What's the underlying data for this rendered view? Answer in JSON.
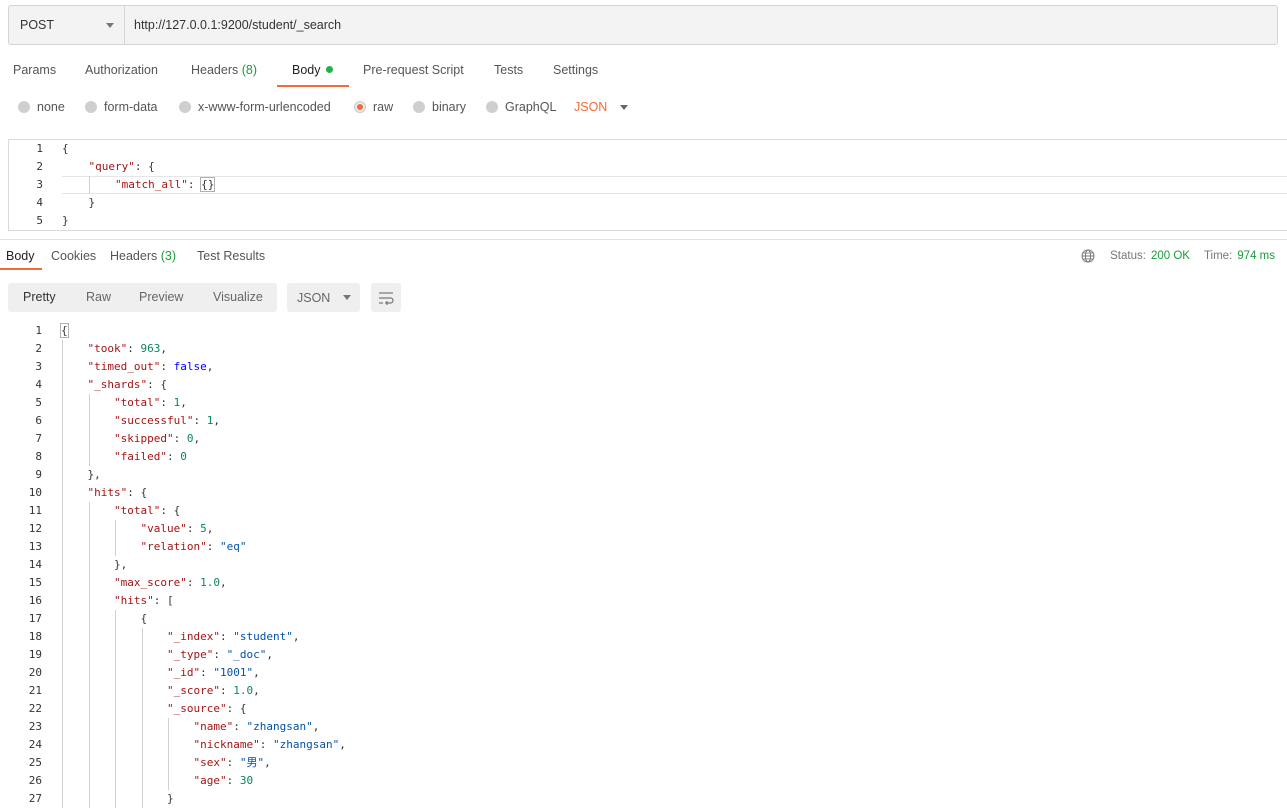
{
  "request": {
    "method": "POST",
    "url": "http://127.0.0.1:9200/student/_search"
  },
  "request_tabs": [
    {
      "label": "Params"
    },
    {
      "label": "Authorization"
    },
    {
      "label": "Headers",
      "count": "(8)"
    },
    {
      "label": "Body",
      "active": true
    },
    {
      "label": "Pre-request Script"
    },
    {
      "label": "Tests"
    },
    {
      "label": "Settings"
    }
  ],
  "body_types": [
    {
      "label": "none"
    },
    {
      "label": "form-data"
    },
    {
      "label": "x-www-form-urlencoded"
    },
    {
      "label": "raw",
      "checked": true
    },
    {
      "label": "binary"
    },
    {
      "label": "GraphQL"
    }
  ],
  "body_format": "JSON",
  "request_body_lines": [
    "1",
    "2",
    "3",
    "4",
    "5"
  ],
  "request_body_tokens": {
    "open": "{",
    "query_key": "\"query\"",
    "colon": ": ",
    "open2": "{",
    "match_all_key": "\"match_all\"",
    "match_all_value": "{}",
    "close2": "}",
    "close": "}"
  },
  "response_tabs": [
    {
      "label": "Body",
      "active": true
    },
    {
      "label": "Cookies"
    },
    {
      "label": "Headers",
      "count": "(3)"
    },
    {
      "label": "Test Results"
    }
  ],
  "status": {
    "status_label": "Status:",
    "status_value": "200 OK",
    "time_label": "Time:",
    "time_value": "974 ms"
  },
  "view_modes": [
    "Pretty",
    "Raw",
    "Preview",
    "Visualize"
  ],
  "response_format": "JSON",
  "response_lines": [
    {
      "n": "1",
      "i": 0,
      "t": [
        [
          "p",
          "{"
        ]
      ]
    },
    {
      "n": "2",
      "i": 1,
      "t": [
        [
          "k",
          "\"took\""
        ],
        [
          "p",
          ": "
        ],
        [
          "n",
          "963"
        ],
        [
          "p",
          ","
        ]
      ]
    },
    {
      "n": "3",
      "i": 1,
      "t": [
        [
          "k",
          "\"timed_out\""
        ],
        [
          "p",
          ": "
        ],
        [
          "b",
          "false"
        ],
        [
          "p",
          ","
        ]
      ]
    },
    {
      "n": "4",
      "i": 1,
      "t": [
        [
          "k",
          "\"_shards\""
        ],
        [
          "p",
          ": {"
        ]
      ]
    },
    {
      "n": "5",
      "i": 2,
      "t": [
        [
          "k",
          "\"total\""
        ],
        [
          "p",
          ": "
        ],
        [
          "n",
          "1"
        ],
        [
          "p",
          ","
        ]
      ]
    },
    {
      "n": "6",
      "i": 2,
      "t": [
        [
          "k",
          "\"successful\""
        ],
        [
          "p",
          ": "
        ],
        [
          "n",
          "1"
        ],
        [
          "p",
          ","
        ]
      ]
    },
    {
      "n": "7",
      "i": 2,
      "t": [
        [
          "k",
          "\"skipped\""
        ],
        [
          "p",
          ": "
        ],
        [
          "n",
          "0"
        ],
        [
          "p",
          ","
        ]
      ]
    },
    {
      "n": "8",
      "i": 2,
      "t": [
        [
          "k",
          "\"failed\""
        ],
        [
          "p",
          ": "
        ],
        [
          "n",
          "0"
        ]
      ]
    },
    {
      "n": "9",
      "i": 1,
      "t": [
        [
          "p",
          "},"
        ]
      ]
    },
    {
      "n": "10",
      "i": 1,
      "t": [
        [
          "k",
          "\"hits\""
        ],
        [
          "p",
          ": {"
        ]
      ]
    },
    {
      "n": "11",
      "i": 2,
      "t": [
        [
          "k",
          "\"total\""
        ],
        [
          "p",
          ": {"
        ]
      ]
    },
    {
      "n": "12",
      "i": 3,
      "t": [
        [
          "k",
          "\"value\""
        ],
        [
          "p",
          ": "
        ],
        [
          "n",
          "5"
        ],
        [
          "p",
          ","
        ]
      ]
    },
    {
      "n": "13",
      "i": 3,
      "t": [
        [
          "k",
          "\"relation\""
        ],
        [
          "p",
          ": "
        ],
        [
          "s",
          "\"eq\""
        ]
      ]
    },
    {
      "n": "14",
      "i": 2,
      "t": [
        [
          "p",
          "},"
        ]
      ]
    },
    {
      "n": "15",
      "i": 2,
      "t": [
        [
          "k",
          "\"max_score\""
        ],
        [
          "p",
          ": "
        ],
        [
          "n",
          "1.0"
        ],
        [
          "p",
          ","
        ]
      ]
    },
    {
      "n": "16",
      "i": 2,
      "t": [
        [
          "k",
          "\"hits\""
        ],
        [
          "p",
          ": ["
        ]
      ]
    },
    {
      "n": "17",
      "i": 3,
      "t": [
        [
          "p",
          "{"
        ]
      ]
    },
    {
      "n": "18",
      "i": 4,
      "t": [
        [
          "k",
          "\"_index\""
        ],
        [
          "p",
          ": "
        ],
        [
          "s",
          "\"student\""
        ],
        [
          "p",
          ","
        ]
      ]
    },
    {
      "n": "19",
      "i": 4,
      "t": [
        [
          "k",
          "\"_type\""
        ],
        [
          "p",
          ": "
        ],
        [
          "s",
          "\"_doc\""
        ],
        [
          "p",
          ","
        ]
      ]
    },
    {
      "n": "20",
      "i": 4,
      "t": [
        [
          "k",
          "\"_id\""
        ],
        [
          "p",
          ": "
        ],
        [
          "s",
          "\"1001\""
        ],
        [
          "p",
          ","
        ]
      ]
    },
    {
      "n": "21",
      "i": 4,
      "t": [
        [
          "k",
          "\"_score\""
        ],
        [
          "p",
          ": "
        ],
        [
          "n",
          "1.0"
        ],
        [
          "p",
          ","
        ]
      ]
    },
    {
      "n": "22",
      "i": 4,
      "t": [
        [
          "k",
          "\"_source\""
        ],
        [
          "p",
          ": {"
        ]
      ]
    },
    {
      "n": "23",
      "i": 5,
      "t": [
        [
          "k",
          "\"name\""
        ],
        [
          "p",
          ": "
        ],
        [
          "s",
          "\"zhangsan\""
        ],
        [
          "p",
          ","
        ]
      ]
    },
    {
      "n": "24",
      "i": 5,
      "t": [
        [
          "k",
          "\"nickname\""
        ],
        [
          "p",
          ": "
        ],
        [
          "s",
          "\"zhangsan\""
        ],
        [
          "p",
          ","
        ]
      ]
    },
    {
      "n": "25",
      "i": 5,
      "t": [
        [
          "k",
          "\"sex\""
        ],
        [
          "p",
          ": "
        ],
        [
          "s",
          "\"男\""
        ],
        [
          "p",
          ","
        ]
      ]
    },
    {
      "n": "26",
      "i": 5,
      "t": [
        [
          "k",
          "\"age\""
        ],
        [
          "p",
          ": "
        ],
        [
          "n",
          "30"
        ]
      ]
    },
    {
      "n": "27",
      "i": 4,
      "t": [
        [
          "p",
          "}"
        ]
      ]
    }
  ]
}
